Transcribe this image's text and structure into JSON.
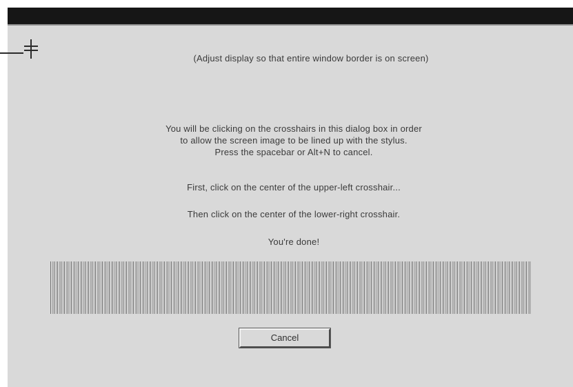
{
  "dialog": {
    "adjust_note": "(Adjust display so that entire window border is on screen)",
    "intro_lines": [
      "You will be clicking on the crosshairs in this dialog box in order",
      "to allow the screen image to be lined up with the stylus.",
      "Press the spacebar or Alt+N to cancel."
    ],
    "step_upper_left": "First, click on the center of the upper-left crosshair...",
    "step_lower_right": "Then click on the center of the lower-right crosshair.",
    "done_message": "You're done!",
    "cancel_label": "Cancel"
  },
  "progress": {
    "fill_fraction": 1.0
  },
  "icons": {
    "crosshair": "crosshair-icon"
  },
  "colors": {
    "title_bar": "#161616",
    "dialog_background": "#d9d9d9",
    "text": "#3a3a3a"
  }
}
